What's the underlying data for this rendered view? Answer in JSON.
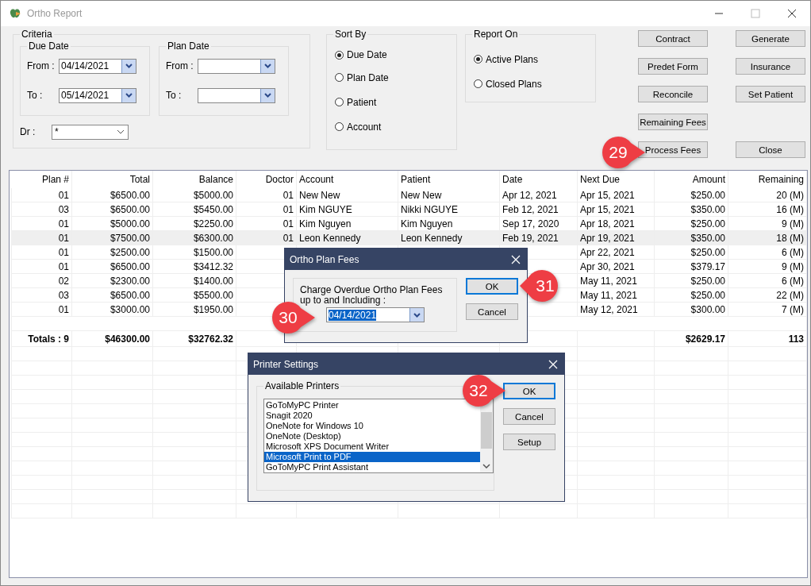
{
  "window": {
    "title": "Ortho Report"
  },
  "criteria": {
    "title": "Criteria",
    "due_date": {
      "title": "Due Date",
      "from_label": "From :",
      "from_value": "04/14/2021",
      "to_label": "To :",
      "to_value": "05/14/2021"
    },
    "plan_date": {
      "title": "Plan Date",
      "from_label": "From :",
      "to_label": "To :"
    },
    "dr_label": "Dr :",
    "dr_value": "*"
  },
  "sort_by": {
    "title": "Sort By",
    "options": [
      {
        "label": "Due Date",
        "selected": true
      },
      {
        "label": "Plan Date",
        "selected": false
      },
      {
        "label": "Patient",
        "selected": false
      },
      {
        "label": "Account",
        "selected": false
      }
    ]
  },
  "report_on": {
    "title": "Report On",
    "options": [
      {
        "label": "Active Plans",
        "selected": true
      },
      {
        "label": "Closed Plans",
        "selected": false
      }
    ]
  },
  "buttons_left": [
    "Contract",
    "Predet Form",
    "Reconcile",
    "Remaining Fees",
    "Process Fees"
  ],
  "buttons_right": [
    "Generate",
    "Insurance",
    "Set Patient",
    "Close"
  ],
  "table": {
    "columns": [
      "Plan #",
      "Total",
      "Balance",
      "Doctor",
      "Account",
      "Patient",
      "Date",
      "Next Due",
      "Amount",
      "Remaining"
    ],
    "rows": [
      {
        "selected": false,
        "plan": "01",
        "total": "$6500.00",
        "balance": "$5000.00",
        "doctor": "01",
        "account": "New New",
        "patient": "New New",
        "date": "Apr 12, 2021",
        "next_due": "Apr 15, 2021",
        "amount": "$250.00",
        "remaining": "20 (M)"
      },
      {
        "selected": false,
        "plan": "03",
        "total": "$6500.00",
        "balance": "$5450.00",
        "doctor": "01",
        "account": "Kim NGUYE",
        "patient": "Nikki NGUYE",
        "date": "Feb 12, 2021",
        "next_due": "Apr 15, 2021",
        "amount": "$350.00",
        "remaining": "16 (M)"
      },
      {
        "selected": false,
        "plan": "01",
        "total": "$5000.00",
        "balance": "$2250.00",
        "doctor": "01",
        "account": "Kim Nguyen",
        "patient": "Kim Nguyen",
        "date": "Sep 17, 2020",
        "next_due": "Apr 18, 2021",
        "amount": "$250.00",
        "remaining": "9 (M)"
      },
      {
        "selected": true,
        "plan": "01",
        "total": "$7500.00",
        "balance": "$6300.00",
        "doctor": "01",
        "account": "Leon Kennedy",
        "patient": "Leon Kennedy",
        "date": "Feb 19, 2021",
        "next_due": "Apr 19, 2021",
        "amount": "$350.00",
        "remaining": "18 (M)"
      },
      {
        "selected": false,
        "plan": "01",
        "total": "$2500.00",
        "balance": "$1500.00",
        "next_due": "Apr 22, 2021",
        "amount": "$250.00",
        "remaining": "6 (M)"
      },
      {
        "selected": false,
        "plan": "01",
        "total": "$6500.00",
        "balance": "$3412.32",
        "next_due": "Apr 30, 2021",
        "amount": "$379.17",
        "remaining": "9 (M)"
      },
      {
        "selected": false,
        "plan": "02",
        "total": "$2300.00",
        "balance": "$1400.00",
        "next_due": "May 11, 2021",
        "amount": "$250.00",
        "remaining": "6 (M)"
      },
      {
        "selected": false,
        "plan": "03",
        "total": "$6500.00",
        "balance": "$5500.00",
        "next_due": "May 11, 2021",
        "amount": "$250.00",
        "remaining": "22 (M)"
      },
      {
        "selected": false,
        "plan": "01",
        "total": "$3000.00",
        "balance": "$1950.00",
        "next_due": "May 12, 2021",
        "amount": "$300.00",
        "remaining": "7 (M)"
      }
    ],
    "totals": {
      "plan": "Totals : 9",
      "total": "$46300.00",
      "balance": "$32762.32",
      "amount": "$2629.17",
      "remaining": "113"
    }
  },
  "plan_fees_dialog": {
    "title": "Ortho Plan Fees",
    "prompt": "Charge Overdue Ortho Plan Fees up to and Including :",
    "date_value": "04/14/2021",
    "buttons": [
      {
        "label": "OK",
        "focused": true
      },
      {
        "label": "Cancel",
        "focused": false
      }
    ]
  },
  "printer_dialog": {
    "title": "Printer Settings",
    "group_title": "Available Printers",
    "printers": [
      {
        "label": "GoToMyPC Printer",
        "selected": false
      },
      {
        "label": "Snagit 2020",
        "selected": false
      },
      {
        "label": "OneNote for Windows 10",
        "selected": false
      },
      {
        "label": "OneNote (Desktop)",
        "selected": false
      },
      {
        "label": "Microsoft XPS Document Writer",
        "selected": false
      },
      {
        "label": "Microsoft Print to PDF",
        "selected": true
      },
      {
        "label": "GoToMyPC Print Assistant",
        "selected": false
      }
    ],
    "buttons": [
      {
        "label": "OK",
        "focused": true
      },
      {
        "label": "Cancel",
        "focused": false
      },
      {
        "label": "Setup",
        "focused": false
      }
    ]
  },
  "callouts": [
    {
      "number": "29"
    },
    {
      "number": "30"
    },
    {
      "number": "31"
    },
    {
      "number": "32"
    }
  ]
}
